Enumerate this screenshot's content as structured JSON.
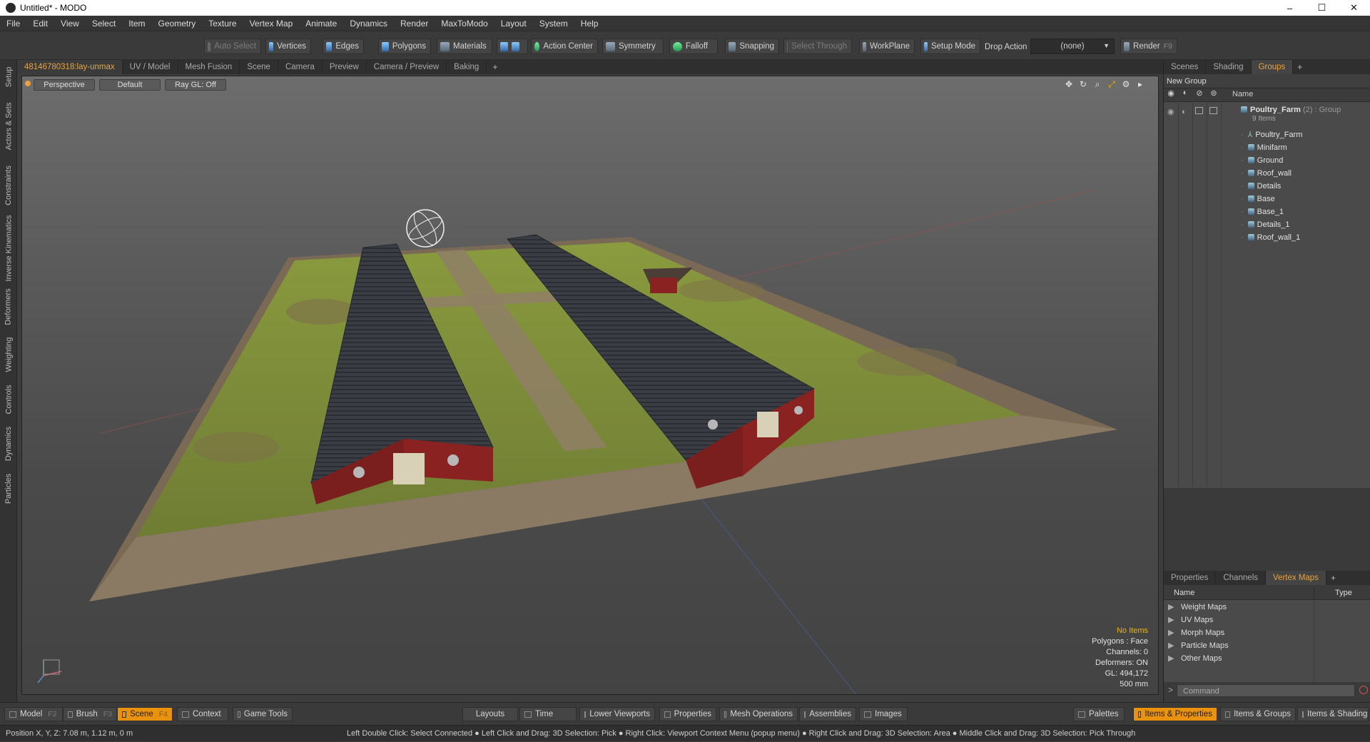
{
  "window": {
    "title": "Untitled* - MODO",
    "min": "–",
    "max": "☐",
    "close": "✕"
  },
  "menu": [
    "File",
    "Edit",
    "View",
    "Select",
    "Item",
    "Geometry",
    "Texture",
    "Vertex Map",
    "Animate",
    "Dynamics",
    "Render",
    "MaxToModo",
    "Layout",
    "System",
    "Help"
  ],
  "toolbar": {
    "auto_select": "Auto Select",
    "vertices": "Vertices",
    "edges": "Edges",
    "polygons": "Polygons",
    "materials": "Materials",
    "action_center": "Action Center",
    "symmetry": "Symmetry",
    "falloff": "Falloff",
    "snapping": "Snapping",
    "select_through": "Select Through",
    "workplane": "WorkPlane",
    "setup_mode": "Setup Mode",
    "drop_action": "Drop Action",
    "drop_value": "(none)",
    "render": "Render",
    "render_key": "F9"
  },
  "left_tabs": [
    "Setup",
    "Actors & Sets",
    "Constraints",
    "Inverse Kinematics",
    "Deformers",
    "Weighting",
    "Controls",
    "Dynamics",
    "Particles"
  ],
  "viewport_tabs": [
    "48146780318:lay-unmax",
    "UV / Model",
    "Mesh Fusion",
    "Scene",
    "Camera",
    "Preview",
    "Camera / Preview",
    "Baking"
  ],
  "viewport": {
    "perspective": "Perspective",
    "shading": "Default",
    "raygl": "Ray GL: Off",
    "info": {
      "no_items": "No Items",
      "polygons": "Polygons : Face",
      "channels": "Channels: 0",
      "deformers": "Deformers: ON",
      "gl": "GL: 494,172",
      "scale": "500 mm"
    }
  },
  "right_tabs_top": [
    "Scenes",
    "Shading",
    "Groups"
  ],
  "groups": {
    "new_group": "New Group",
    "name_header": "Name",
    "root": {
      "name": "Poultry_Farm",
      "count": "(2)",
      "type": ": Group",
      "sub": "9 Items"
    },
    "children": [
      "Poultry_Farm",
      "Minifarm",
      "Ground",
      "Roof_wall",
      "Details",
      "Base",
      "Base_1",
      "Details_1",
      "Roof_wall_1"
    ]
  },
  "right_tabs_bottom": [
    "Properties",
    "Channels",
    "Vertex Maps"
  ],
  "vertex_maps": {
    "name_header": "Name",
    "type_header": "Type",
    "rows": [
      "Weight Maps",
      "UV Maps",
      "Morph Maps",
      "Particle Maps",
      "Other Maps"
    ]
  },
  "command": {
    "prompt": ">",
    "placeholder": "Command"
  },
  "bottom": {
    "model": "Model",
    "model_key": "F2",
    "brush": "Brush",
    "brush_key": "F3",
    "scene": "Scene",
    "scene_key": "F4",
    "context": "Context",
    "game_tools": "Game Tools",
    "layouts": "Layouts",
    "time": "Time",
    "lower_viewports": "Lower Viewports",
    "properties": "Properties",
    "mesh_operations": "Mesh Operations",
    "assemblies": "Assemblies",
    "images": "Images",
    "palettes": "Palettes",
    "items_properties": "Items & Properties",
    "items_groups": "Items & Groups",
    "items_shading": "Items & Shading"
  },
  "status": {
    "position": "Position X, Y, Z:   7.08 m, 1.12 m, 0 m",
    "hint": "Left Double Click: Select Connected ● Left Click and Drag: 3D Selection: Pick ● Right Click: Viewport Context Menu (popup menu) ● Right Click and Drag: 3D Selection: Area ● Middle Click and Drag: 3D Selection: Pick Through"
  }
}
